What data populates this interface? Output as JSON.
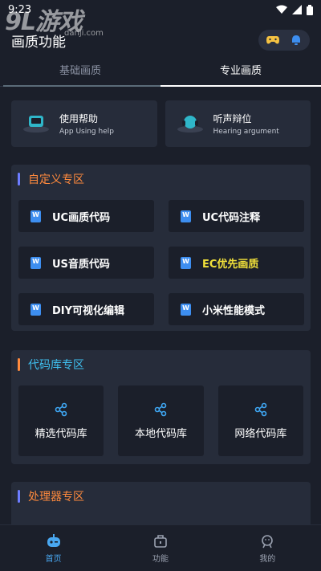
{
  "status_bar": {
    "time": "9:23"
  },
  "watermark": {
    "main": "9L游戏",
    "sub": "danji.com"
  },
  "app_bar": {
    "title": "画质功能"
  },
  "tabs": [
    {
      "label": "基础画质",
      "active": false
    },
    {
      "label": "专业画质",
      "active": true
    }
  ],
  "help_cards": [
    {
      "title": "使用帮助",
      "subtitle": "App Using help",
      "icon": "tv-icon"
    },
    {
      "title": "听声辩位",
      "subtitle": "Hearing argument",
      "icon": "headset-icon"
    }
  ],
  "custom_section": {
    "title": "自定义专区",
    "title_color": "#ff8a3d",
    "bar_color": "#6c7cff",
    "items": [
      {
        "label": "UC画质代码",
        "color": "#ffffff"
      },
      {
        "label": "UC代码注释",
        "color": "#ffffff"
      },
      {
        "label": "US音质代码",
        "color": "#ffffff"
      },
      {
        "label": "EC优先画质",
        "color": "#f2e13a"
      },
      {
        "label": "DIY可视化编辑",
        "color": "#ffffff"
      },
      {
        "label": "小米性能模式",
        "color": "#ffffff"
      }
    ]
  },
  "library_section": {
    "title": "代码库专区",
    "title_color": "#3fc0f0",
    "bar_color": "#ff8a3d",
    "items": [
      {
        "label": "精选代码库"
      },
      {
        "label": "本地代码库"
      },
      {
        "label": "网络代码库"
      }
    ]
  },
  "processor_section": {
    "title": "处理器专区",
    "title_color": "#ff8a3d",
    "bar_color": "#6c7cff"
  },
  "bottom_nav": [
    {
      "label": "首页",
      "icon": "gamepad-icon",
      "active": true
    },
    {
      "label": "功能",
      "icon": "toolbox-icon",
      "active": false
    },
    {
      "label": "我的",
      "icon": "profile-icon",
      "active": false
    }
  ],
  "colors": {
    "background": "#1b1f2a",
    "card": "#262c3a",
    "accent": "#49a7f0",
    "icon_blue": "#3d8ef0"
  }
}
